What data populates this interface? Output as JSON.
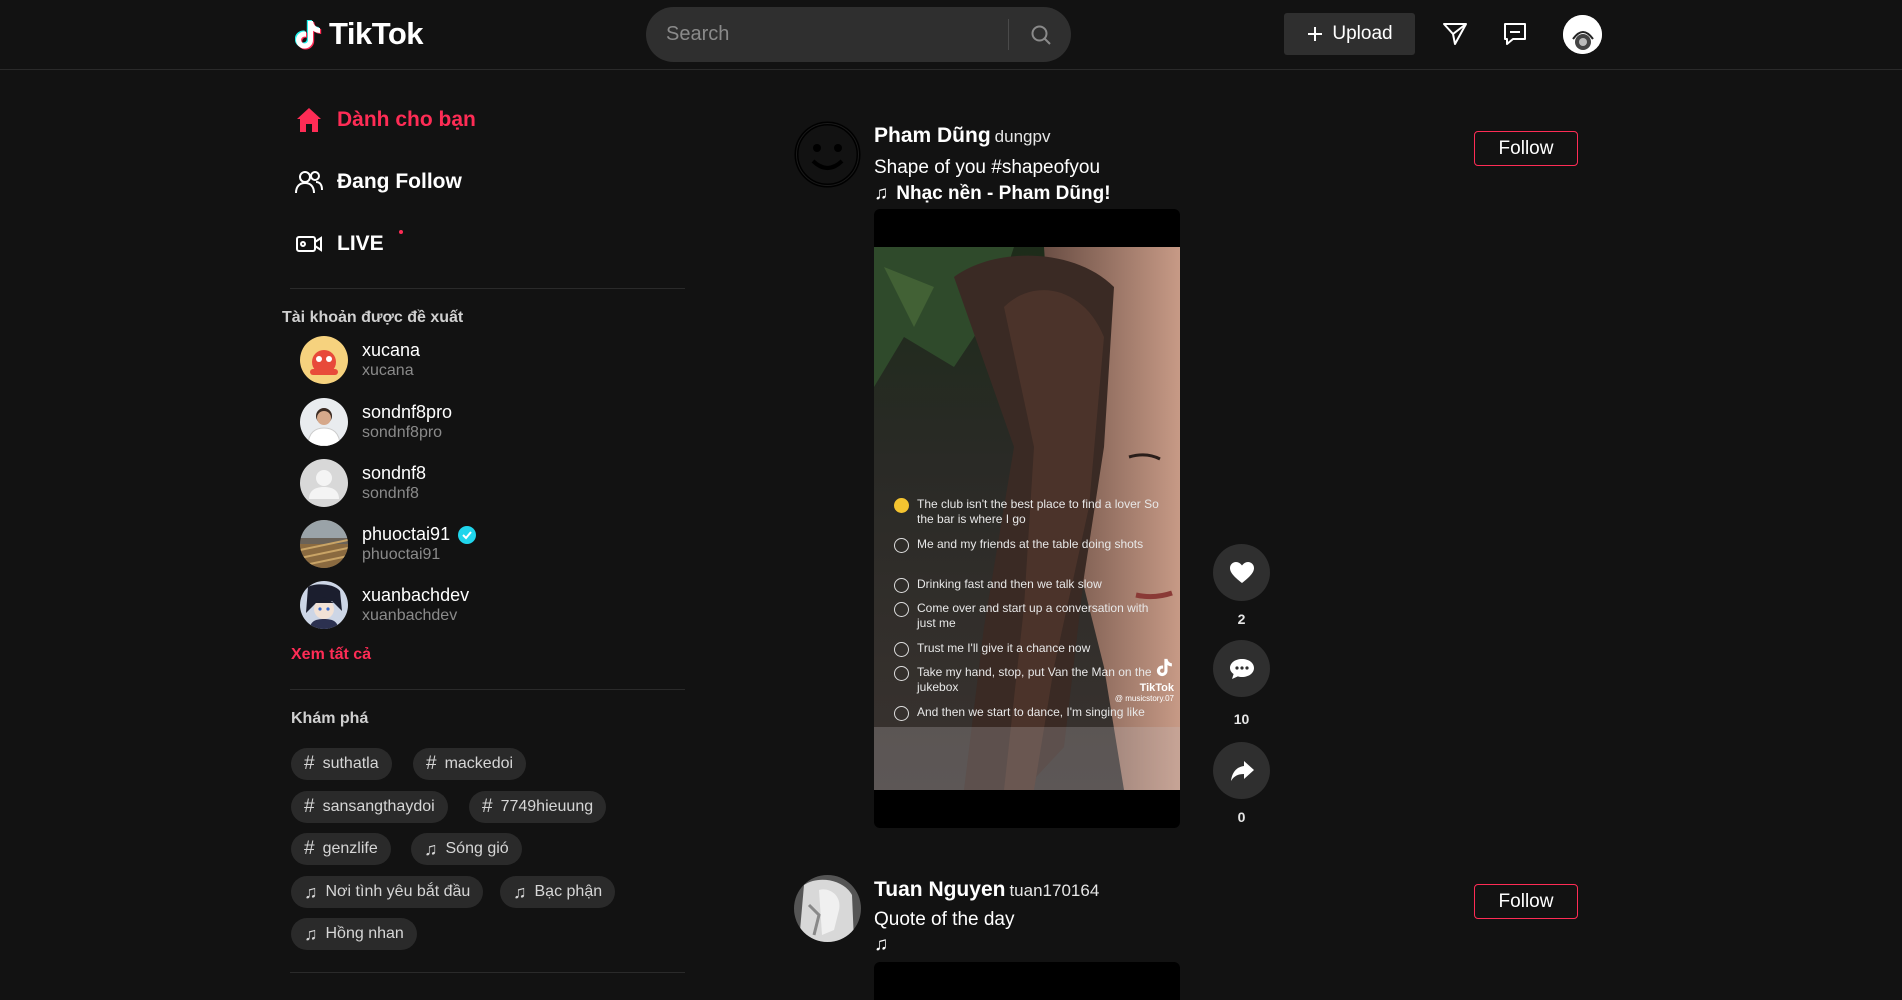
{
  "header": {
    "logo_text": "TikTok",
    "search_placeholder": "Search",
    "upload_label": "Upload"
  },
  "sidebar": {
    "nav": [
      {
        "label": "Dành cho bạn",
        "icon": "home-icon",
        "active": true
      },
      {
        "label": "Đang Follow",
        "icon": "users-icon",
        "active": false
      },
      {
        "label": "LIVE",
        "icon": "live-camera-icon",
        "active": false
      }
    ],
    "suggested_title": "Tài khoản được đề xuất",
    "accounts": [
      {
        "name": "xucana",
        "handle": "xucana",
        "verified": false
      },
      {
        "name": "sondnf8pro",
        "handle": "sondnf8pro",
        "verified": false
      },
      {
        "name": "sondnf8",
        "handle": "sondnf8",
        "verified": false
      },
      {
        "name": "phuoctai91",
        "handle": "phuoctai91",
        "verified": true
      },
      {
        "name": "xuanbachdev",
        "handle": "xuanbachdev",
        "verified": false
      }
    ],
    "see_all": "Xem tất cả",
    "discover_title": "Khám phá",
    "tags": [
      {
        "type": "hashtag",
        "label": "suthatla"
      },
      {
        "type": "hashtag",
        "label": "mackedoi"
      },
      {
        "type": "hashtag",
        "label": "sansangthaydoi"
      },
      {
        "type": "hashtag",
        "label": "7749hieuung"
      },
      {
        "type": "hashtag",
        "label": "genzlife"
      },
      {
        "type": "music",
        "label": "Sóng gió"
      },
      {
        "type": "music",
        "label": "Nơi tình yêu bắt đầu"
      },
      {
        "type": "music",
        "label": "Bạc phận"
      },
      {
        "type": "music",
        "label": "Hồng nhan"
      }
    ]
  },
  "feed": {
    "posts": [
      {
        "author": "Pham Dũng",
        "username": "dungpv",
        "caption": "Shape of you #shapeofyou",
        "music": "Nhạc nền - Pham Dũng!",
        "follow_label": "Follow",
        "likes": "2",
        "comments": "10",
        "shares": "0",
        "video_overlay": {
          "lyrics": [
            {
              "text": "The club isn't the best place to find a lover  So the bar is where I go",
              "checked": true
            },
            {
              "text": "Me and my friends at the table doing shots",
              "checked": false
            },
            {
              "text": "Drinking fast and then we talk slow",
              "checked": false
            },
            {
              "text": "Come over and start up a conversation with just me",
              "checked": false
            },
            {
              "text": "Trust me I'll give it a chance now",
              "checked": false
            },
            {
              "text": "Take my hand, stop, put Van the Man on the jukebox",
              "checked": false
            },
            {
              "text": "And then we start to dance, I'm singing like",
              "checked": false
            }
          ],
          "watermark": "TikTok",
          "watermark_handle": "@ musicstory.07"
        }
      },
      {
        "author": "Tuan Nguyen",
        "username": "tuan170164",
        "caption": "Quote of the day",
        "music": "",
        "follow_label": "Follow"
      }
    ]
  },
  "colors": {
    "accent": "#fe2c55",
    "background": "#121212",
    "verified": "#20d5ec"
  }
}
